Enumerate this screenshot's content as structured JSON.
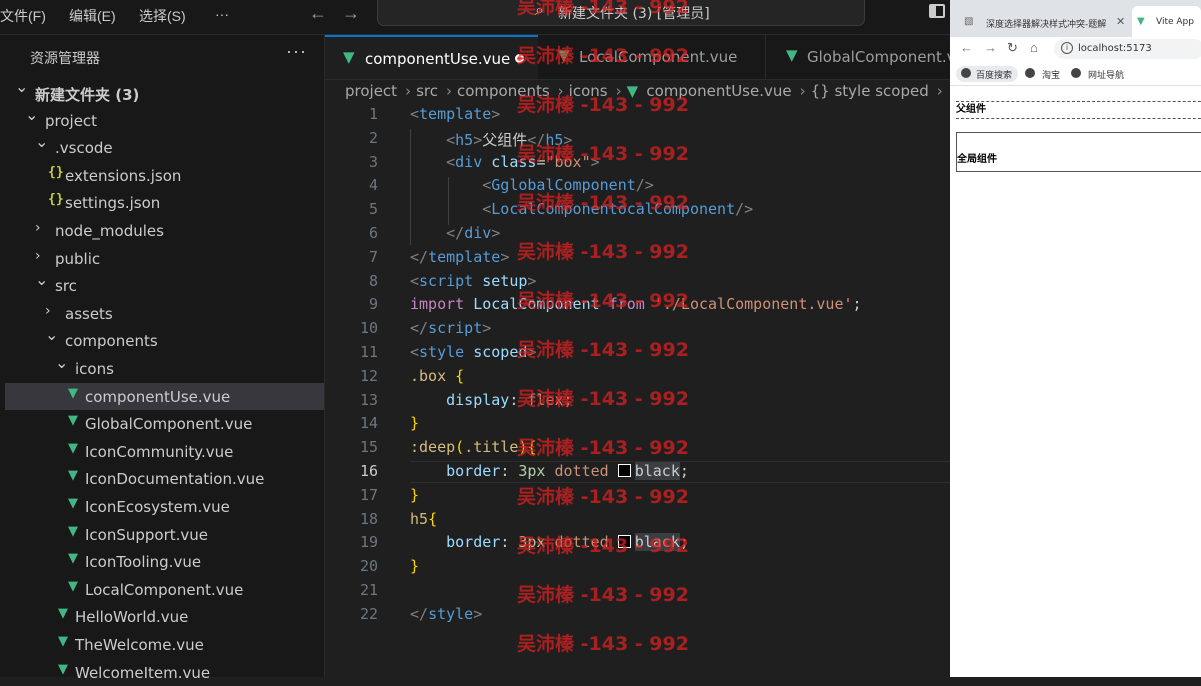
{
  "menu": {
    "file": "文件(F)",
    "edit": "编辑(E)",
    "select": "选择(S)",
    "more": "···"
  },
  "command_center": {
    "text": "新建文件夹 (3) [管理员]"
  },
  "explorer": {
    "title": "资源管理器",
    "more": "···",
    "items": [
      {
        "label": "新建文件夹 (3)",
        "type": "folder-open",
        "depth": 0
      },
      {
        "label": "project",
        "type": "folder-open",
        "depth": 1
      },
      {
        "label": ".vscode",
        "type": "folder-open",
        "depth": 2
      },
      {
        "label": "extensions.json",
        "type": "json",
        "depth": 3
      },
      {
        "label": "settings.json",
        "type": "json",
        "depth": 3
      },
      {
        "label": "node_modules",
        "type": "folder-closed",
        "depth": 2
      },
      {
        "label": "public",
        "type": "folder-closed",
        "depth": 2
      },
      {
        "label": "src",
        "type": "folder-open",
        "depth": 2
      },
      {
        "label": "assets",
        "type": "folder-closed",
        "depth": 3
      },
      {
        "label": "components",
        "type": "folder-open",
        "depth": 3
      },
      {
        "label": "icons",
        "type": "folder-open",
        "depth": 4
      },
      {
        "label": "componentUse.vue",
        "type": "vue",
        "depth": 5,
        "selected": true
      },
      {
        "label": "GlobalComponent.vue",
        "type": "vue",
        "depth": 5
      },
      {
        "label": "IconCommunity.vue",
        "type": "vue",
        "depth": 5
      },
      {
        "label": "IconDocumentation.vue",
        "type": "vue",
        "depth": 5
      },
      {
        "label": "IconEcosystem.vue",
        "type": "vue",
        "depth": 5
      },
      {
        "label": "IconSupport.vue",
        "type": "vue",
        "depth": 5
      },
      {
        "label": "IconTooling.vue",
        "type": "vue",
        "depth": 5
      },
      {
        "label": "LocalComponent.vue",
        "type": "vue",
        "depth": 5
      },
      {
        "label": "HelloWorld.vue",
        "type": "vue",
        "depth": 4
      },
      {
        "label": "TheWelcome.vue",
        "type": "vue",
        "depth": 4
      },
      {
        "label": "WelcomeItem.vue",
        "type": "vue",
        "depth": 4
      }
    ]
  },
  "tabs": [
    {
      "label": "componentUse.vue",
      "active": true,
      "modified": true
    },
    {
      "label": "LocalComponent.vue",
      "active": false
    },
    {
      "label": "GlobalComponent.v",
      "active": false
    }
  ],
  "breadcrumb": [
    "project",
    "src",
    "components",
    "icons",
    "componentUse.vue",
    "{} style scoped"
  ],
  "editor": {
    "current_line": 16,
    "lines": [
      [
        [
          "t-brk",
          "<"
        ],
        [
          "t-tag",
          "template"
        ],
        [
          "t-brk",
          ">"
        ]
      ],
      [
        [
          "t-pl",
          "    "
        ],
        [
          "t-brk",
          "<"
        ],
        [
          "t-tag",
          "h5"
        ],
        [
          "t-brk",
          ">"
        ],
        [
          "t-pl",
          "父组件"
        ],
        [
          "t-brk",
          "</"
        ],
        [
          "t-tag",
          "h5"
        ],
        [
          "t-brk",
          ">"
        ]
      ],
      [
        [
          "t-pl",
          "    "
        ],
        [
          "t-brk",
          "<"
        ],
        [
          "t-tag",
          "div"
        ],
        [
          "t-pl",
          " "
        ],
        [
          "t-attr",
          "class"
        ],
        [
          "t-pl",
          "="
        ],
        [
          "t-str",
          "\"box\""
        ],
        [
          "t-brk",
          ">"
        ]
      ],
      [
        [
          "t-pl",
          "        "
        ],
        [
          "t-brk",
          "<"
        ],
        [
          "t-tag",
          "GglobalComponent"
        ],
        [
          "t-brk",
          "/>"
        ]
      ],
      [
        [
          "t-pl",
          "        "
        ],
        [
          "t-brk",
          "<"
        ],
        [
          "t-tag",
          "LocalComponentocalComponent"
        ],
        [
          "t-brk",
          "/>"
        ]
      ],
      [
        [
          "t-pl",
          "    "
        ],
        [
          "t-brk",
          "</"
        ],
        [
          "t-tag",
          "div"
        ],
        [
          "t-brk",
          ">"
        ]
      ],
      [
        [
          "t-brk",
          "</"
        ],
        [
          "t-tag",
          "template"
        ],
        [
          "t-brk",
          ">"
        ]
      ],
      [
        [
          "t-brk",
          "<"
        ],
        [
          "t-tag",
          "script"
        ],
        [
          "t-pl",
          " "
        ],
        [
          "t-attr",
          "setup"
        ],
        [
          "t-brk",
          ">"
        ]
      ],
      [
        [
          "t-kw",
          "import"
        ],
        [
          "t-pl",
          " "
        ],
        [
          "t-var",
          "LocalComponent"
        ],
        [
          "t-pl",
          " "
        ],
        [
          "t-kw",
          "from"
        ],
        [
          "t-pl",
          " "
        ],
        [
          "t-str",
          "'./LocalComponent.vue'"
        ],
        [
          "t-pl",
          ";"
        ]
      ],
      [
        [
          "t-brk",
          "</"
        ],
        [
          "t-tag",
          "script"
        ],
        [
          "t-brk",
          ">"
        ]
      ],
      [
        [
          "t-brk",
          "<"
        ],
        [
          "t-tag",
          "style"
        ],
        [
          "t-pl",
          " "
        ],
        [
          "t-attr",
          "scoped"
        ],
        [
          "t-brk",
          ">"
        ]
      ],
      [
        [
          "t-sel",
          ".box"
        ],
        [
          "t-pl",
          " "
        ],
        [
          "t-y",
          "{"
        ]
      ],
      [
        [
          "t-pl",
          "    "
        ],
        [
          "t-prop",
          "display"
        ],
        [
          "t-pl",
          ": "
        ],
        [
          "t-v",
          "flex"
        ],
        [
          "t-pl",
          ";"
        ]
      ],
      [
        [
          "t-y",
          "}"
        ]
      ],
      [
        [
          "t-sel",
          ":deep"
        ],
        [
          "t-y",
          "("
        ],
        [
          "t-sel",
          ".title"
        ],
        [
          "t-y",
          "){"
        ]
      ],
      [
        [
          "t-pl",
          "    "
        ],
        [
          "t-prop",
          "border"
        ],
        [
          "t-pl",
          ": "
        ],
        [
          "t-num",
          "3px"
        ],
        [
          "t-pl",
          " "
        ],
        [
          "t-v",
          "dotted"
        ],
        [
          "t-pl",
          " "
        ],
        [
          "swatch",
          ""
        ],
        [
          "hl",
          "black"
        ],
        [
          "t-pl",
          ";"
        ]
      ],
      [
        [
          "t-y",
          "}"
        ]
      ],
      [
        [
          "t-sel",
          "h5"
        ],
        [
          "t-y",
          "{"
        ]
      ],
      [
        [
          "t-pl",
          "    "
        ],
        [
          "t-prop",
          "border"
        ],
        [
          "t-pl",
          ": "
        ],
        [
          "t-num",
          "3px"
        ],
        [
          "t-pl",
          " "
        ],
        [
          "t-v",
          "dotted"
        ],
        [
          "t-pl",
          " "
        ],
        [
          "swatch",
          ""
        ],
        [
          "hl",
          "black"
        ],
        [
          "t-pl",
          ";"
        ]
      ],
      [
        [
          "t-y",
          "}"
        ]
      ],
      [],
      [
        [
          "t-brk",
          "</"
        ],
        [
          "t-tag",
          "style"
        ],
        [
          "t-brk",
          ">"
        ]
      ]
    ]
  },
  "watermark": {
    "text": "吴沛榛 -143 - 992",
    "color": "#e02020"
  },
  "browser": {
    "tabs": [
      {
        "label": "深度选择器解决样式冲突-题解",
        "active": false
      },
      {
        "label": "Vite App",
        "active": true
      }
    ],
    "url": "localhost:5173",
    "bookmarks": [
      "百度搜索",
      "淘宝",
      "网址导航"
    ],
    "page": {
      "h5": "父组件",
      "global_component": "全局组件"
    }
  },
  "colors": {
    "accent": "#0078d4",
    "vue": "#41b883",
    "json": "#cbcb41"
  }
}
